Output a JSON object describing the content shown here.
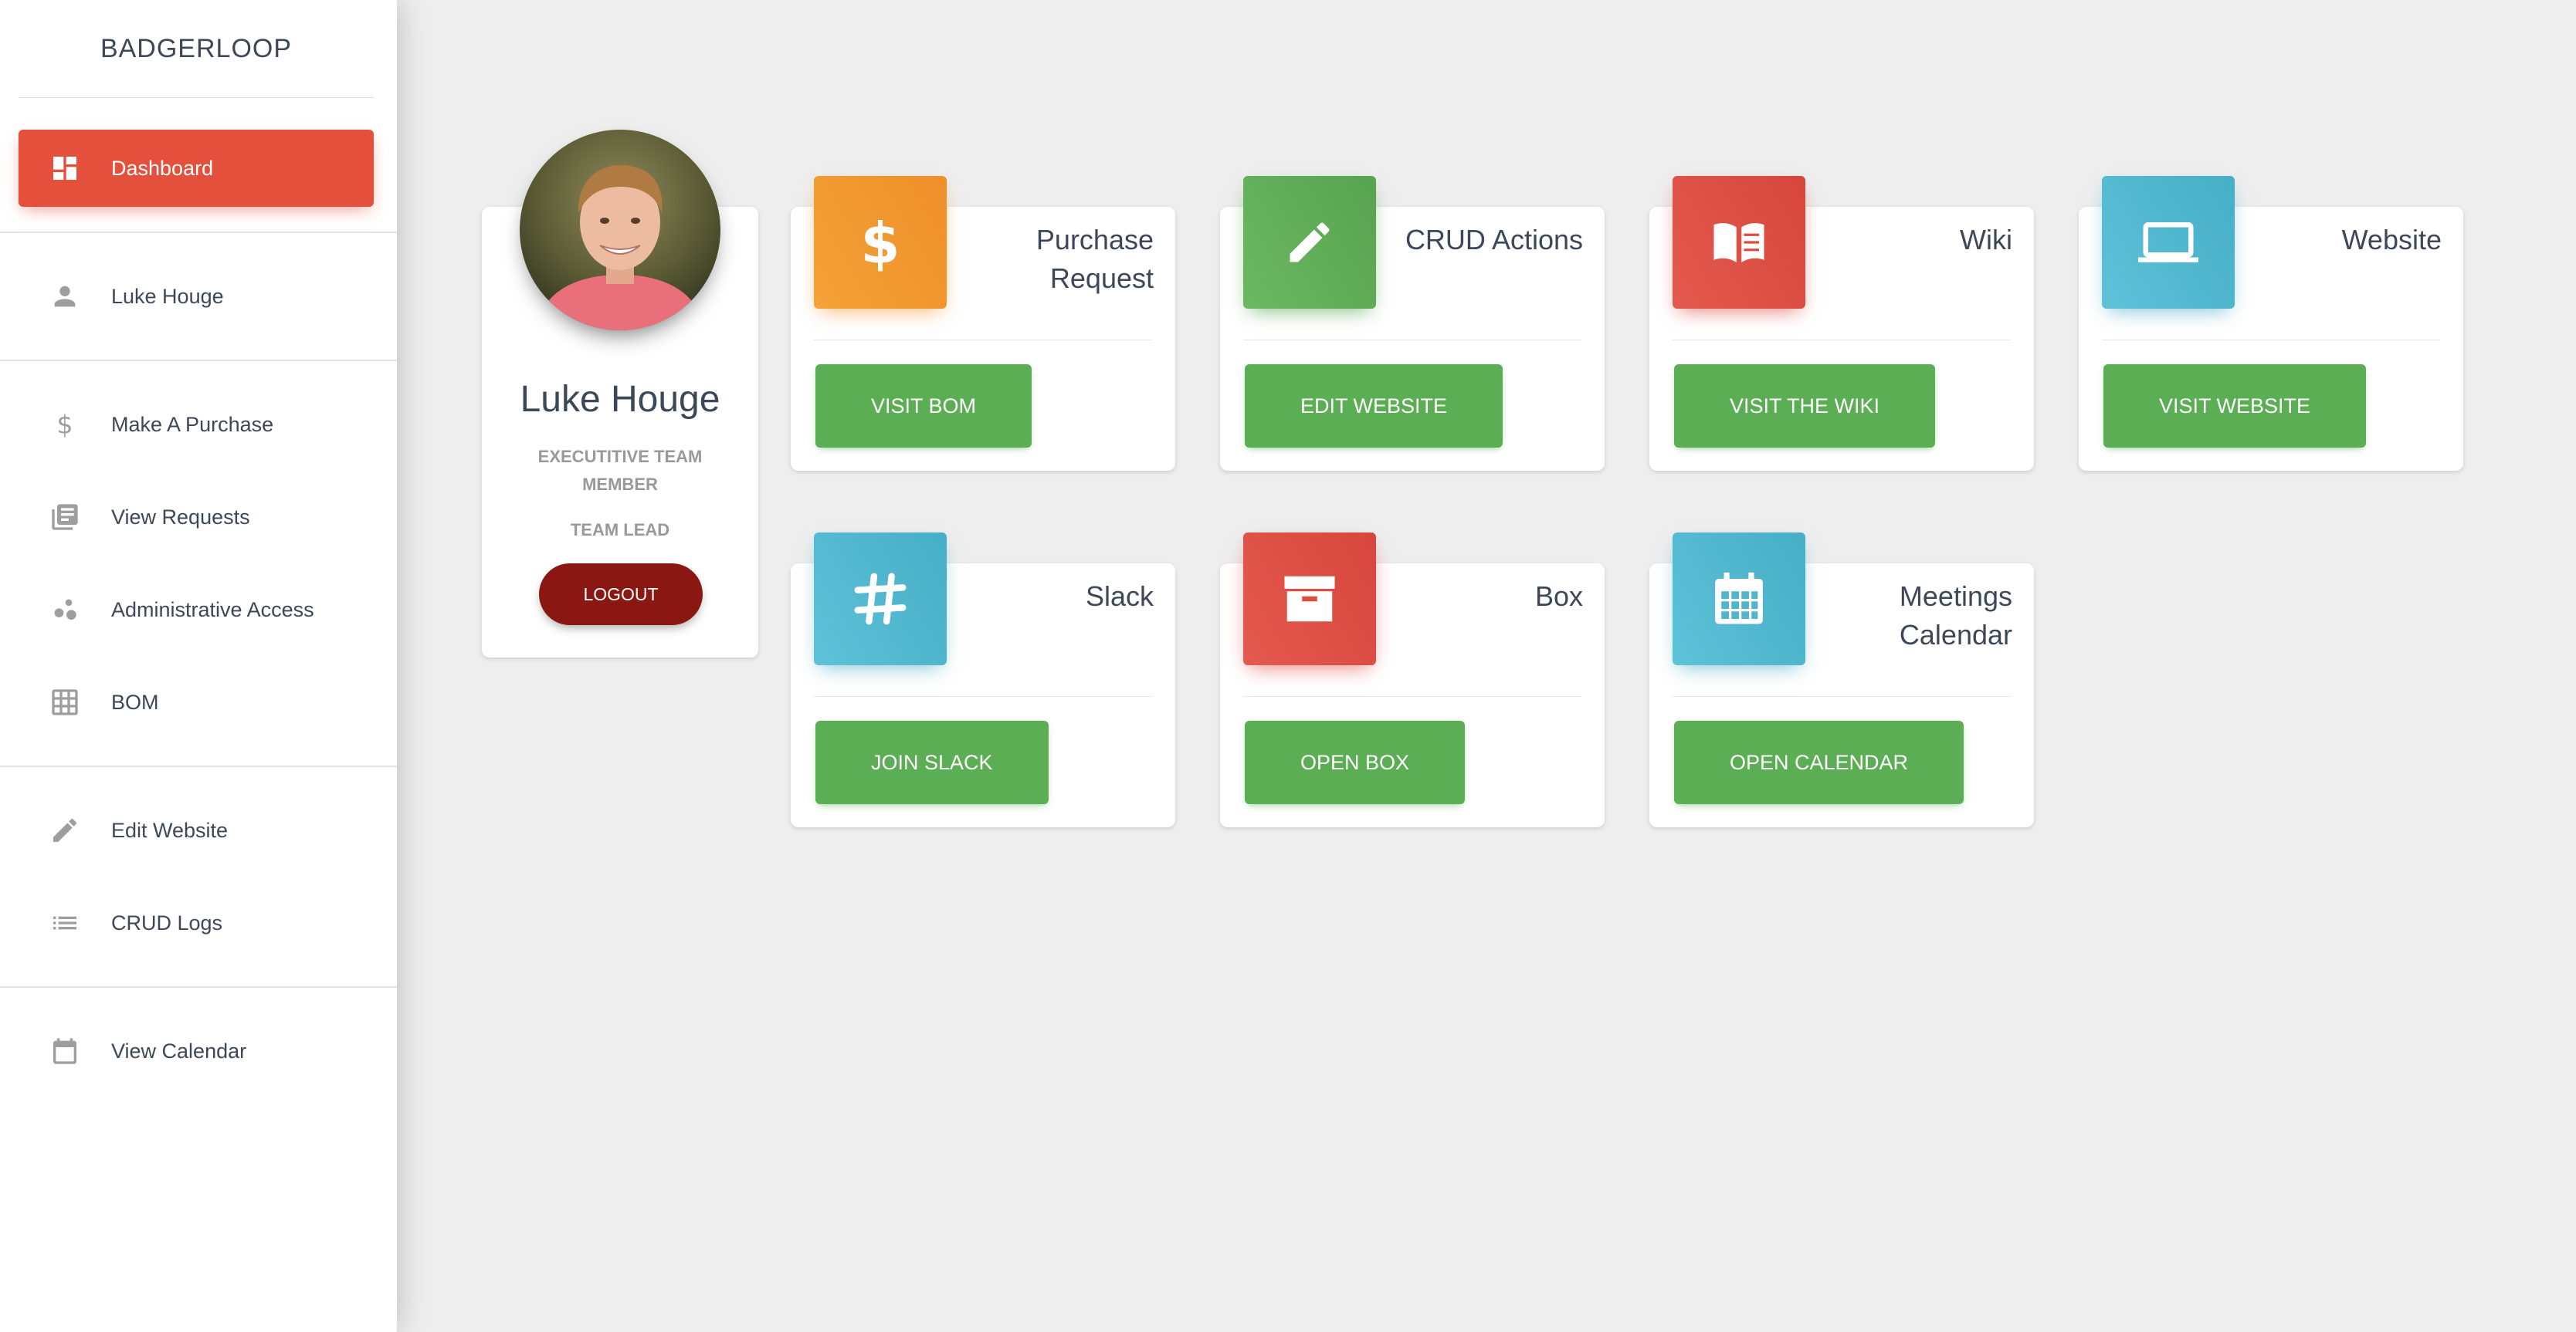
{
  "sidebar": {
    "brand": "BADGERLOOP",
    "items": [
      {
        "label": "Dashboard",
        "icon": "dashboard-icon",
        "active": true
      },
      {
        "label": "Luke Houge",
        "icon": "person-icon"
      },
      {
        "label": "Make A Purchase",
        "icon": "dollar-icon"
      },
      {
        "label": "View Requests",
        "icon": "library-books-icon"
      },
      {
        "label": "Administrative Access",
        "icon": "bubble-chart-icon"
      },
      {
        "label": "BOM",
        "icon": "grid-icon"
      },
      {
        "label": "Edit Website",
        "icon": "pencil-icon"
      },
      {
        "label": "CRUD Logs",
        "icon": "list-icon"
      },
      {
        "label": "View Calendar",
        "icon": "calendar-icon"
      }
    ]
  },
  "profile": {
    "name": "Luke Houge",
    "role": "EXECUTITIVE TEAM MEMBER",
    "position": "TEAM LEAD",
    "logout_label": "LOGOUT"
  },
  "tiles": [
    {
      "title": "Purchase Request",
      "button": "VISIT BOM",
      "icon": "dollar-icon",
      "color": "#f0972e"
    },
    {
      "title": "CRUD Actions",
      "button": "EDIT WEBSITE",
      "icon": "pencil-icon",
      "color": "#5fab56"
    },
    {
      "title": "Wiki",
      "button": "VISIT THE WIKI",
      "icon": "book-icon",
      "color": "#dc4c42"
    },
    {
      "title": "Website",
      "button": "VISIT WEBSITE",
      "icon": "laptop-icon",
      "color": "#4fb6cd"
    },
    {
      "title": "Slack",
      "button": "JOIN SLACK",
      "icon": "slack-icon",
      "color": "#4fb6cd"
    },
    {
      "title": "Box",
      "button": "OPEN BOX",
      "icon": "archive-box-icon",
      "color": "#dc4c42"
    },
    {
      "title": "Meetings Calendar",
      "button": "OPEN CALENDAR",
      "icon": "calendar-icon",
      "color": "#4fb6cd"
    }
  ],
  "colors": {
    "accent": "#e4503c",
    "button_green": "#5cae55",
    "logout": "#8b1712",
    "text": "#3c4858",
    "background": "#eeeeee"
  }
}
